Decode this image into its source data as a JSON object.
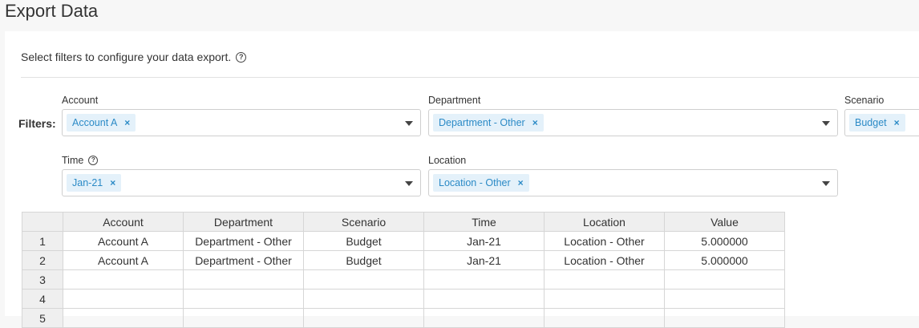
{
  "page": {
    "title": "Export Data"
  },
  "intro": {
    "text": "Select filters to configure your data export."
  },
  "filters": {
    "label": "Filters:",
    "account": {
      "label": "Account",
      "tag": "Account A"
    },
    "department": {
      "label": "Department",
      "tag": "Department - Other"
    },
    "scenario": {
      "label": "Scenario",
      "tag": "Budget"
    },
    "time": {
      "label": "Time",
      "tag": "Jan-21"
    },
    "location": {
      "label": "Location",
      "tag": "Location - Other"
    },
    "remove_glyph": "×"
  },
  "grid": {
    "columns": [
      "Account",
      "Department",
      "Scenario",
      "Time",
      "Location",
      "Value"
    ],
    "rows": [
      {
        "n": "1",
        "cells": [
          "Account A",
          "Department - Other",
          "Budget",
          "Jan-21",
          "Location - Other",
          "5.000000"
        ]
      },
      {
        "n": "2",
        "cells": [
          "Account A",
          "Department - Other",
          "Budget",
          "Jan-21",
          "Location - Other",
          "5.000000"
        ]
      },
      {
        "n": "3",
        "cells": [
          "",
          "",
          "",
          "",
          "",
          ""
        ]
      },
      {
        "n": "4",
        "cells": [
          "",
          "",
          "",
          "",
          "",
          ""
        ]
      },
      {
        "n": "5",
        "cells": [
          "",
          "",
          "",
          "",
          "",
          ""
        ]
      }
    ]
  },
  "icons": {
    "help": "help-circle-icon",
    "dropdown": "caret-down-icon",
    "remove": "close-icon"
  }
}
